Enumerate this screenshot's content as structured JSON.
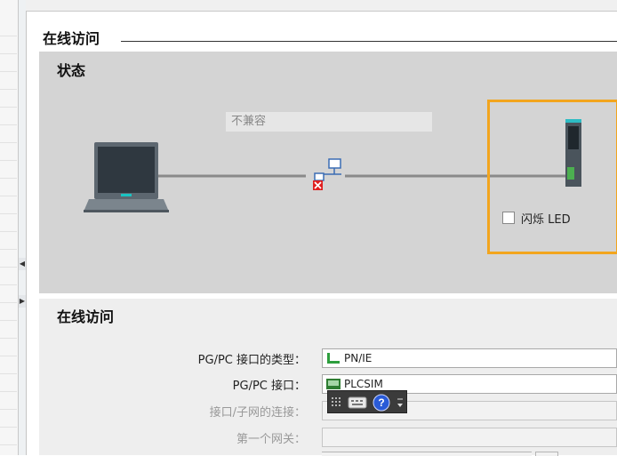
{
  "section": {
    "title": "在线访问"
  },
  "status": {
    "title": "状态",
    "connection_text": "不兼容",
    "blink_led_label": "闪烁 LED",
    "blink_led_checked": false
  },
  "access": {
    "title": "在线访问",
    "fields": [
      {
        "label": "PG/PC 接口的类型：",
        "value": "PN/IE",
        "enabled": true
      },
      {
        "label": "PG/PC 接口：",
        "value": "PLCSIM",
        "enabled": true
      },
      {
        "label": "接口/子网的连接：",
        "value": "",
        "enabled": false
      },
      {
        "label": "第一个网关：",
        "value": "",
        "enabled": false
      }
    ]
  },
  "colors": {
    "highlight_frame": "#f2a51e",
    "panel_bg": "#d4d4d4",
    "link_line": "#888888",
    "error_red": "#e02020"
  },
  "icons": {
    "pc": "laptop-icon",
    "network": "network-error-icon",
    "plc": "plc-module-icon",
    "pnie": "pn-ie-icon",
    "plcsim": "plcsim-icon",
    "toolbar": [
      "grip-icon",
      "keyboard-icon",
      "help-icon",
      "dropdown-icon"
    ]
  }
}
